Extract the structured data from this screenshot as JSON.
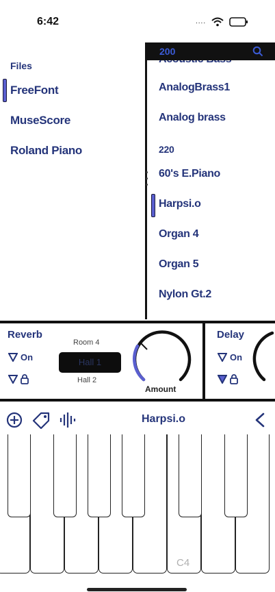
{
  "status_bar": {
    "time": "6:42",
    "signal": "....",
    "wifi_icon": "wifi-icon",
    "battery_icon": "battery-icon"
  },
  "files": {
    "title": "Files",
    "items": [
      "FreeFont",
      "MuseScore",
      "Roland Piano"
    ],
    "selected": "FreeFont"
  },
  "presets": {
    "bank": "200",
    "search_icon": "search-icon",
    "items": [
      {
        "label": "Acoustic Bass",
        "kind": "preset"
      },
      {
        "label": "AnalogBrass1",
        "kind": "preset"
      },
      {
        "label": "Analog brass",
        "kind": "preset"
      },
      {
        "label": "220",
        "kind": "header"
      },
      {
        "label": "60's E.Piano",
        "kind": "preset"
      },
      {
        "label": "Harpsi.o",
        "kind": "preset"
      },
      {
        "label": "Organ 4",
        "kind": "preset"
      },
      {
        "label": "Organ 5",
        "kind": "preset"
      },
      {
        "label": "Nylon Gt.2",
        "kind": "preset"
      }
    ],
    "selected": "Harpsi.o"
  },
  "reverb": {
    "title": "Reverb",
    "on_label": "On",
    "room_prev": "Room 4",
    "room_selected": "Hall 1",
    "room_next": "Hall 2",
    "knob_label": "Amount"
  },
  "delay": {
    "title": "Delay",
    "on_label": "On"
  },
  "toolbar": {
    "title": "Harpsi.o"
  },
  "keyboard": {
    "label": "C4"
  },
  "colors": {
    "accent": "#5a5fcf",
    "text": "#24347a",
    "bank": "#3b5bd6"
  }
}
